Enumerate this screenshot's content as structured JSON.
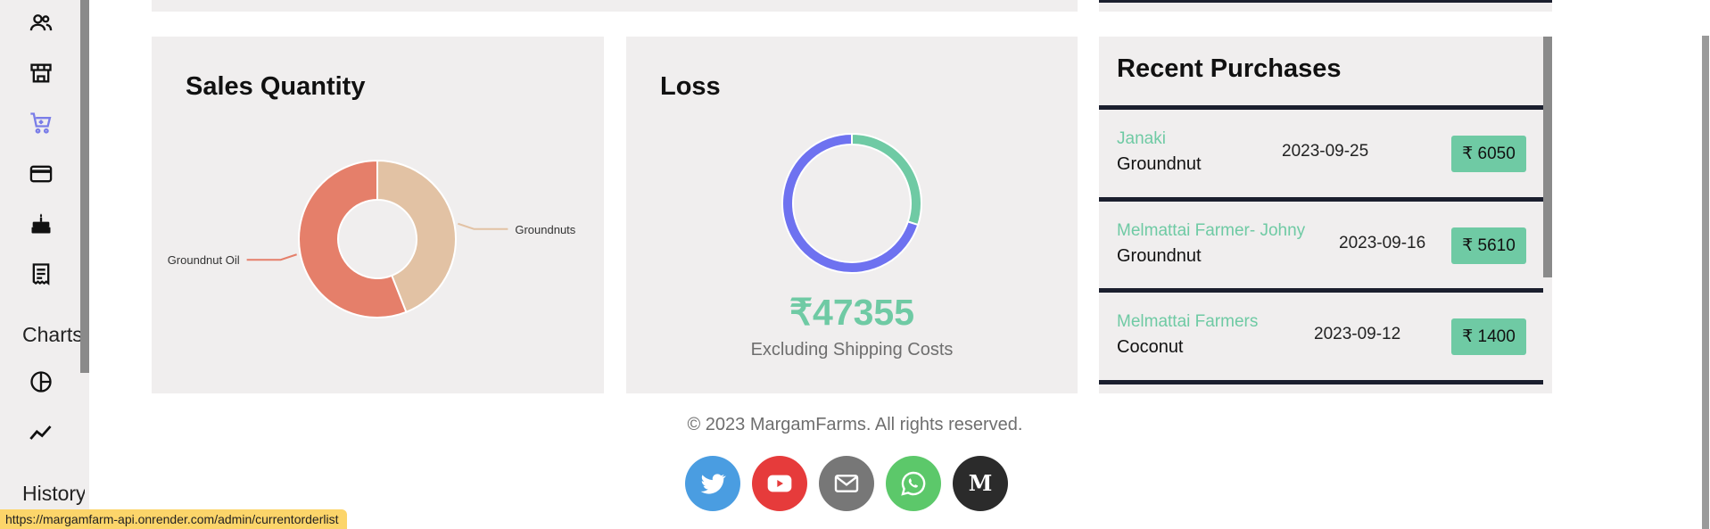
{
  "sidebar": {
    "icons": [
      {
        "name": "users-icon"
      },
      {
        "name": "store-icon"
      },
      {
        "name": "cart-icon",
        "active": true
      },
      {
        "name": "credit-card-icon"
      },
      {
        "name": "cake-icon"
      },
      {
        "name": "receipt-icon"
      }
    ],
    "charts_label": "Charts",
    "chart_icons": [
      {
        "name": "pie-chart-icon"
      },
      {
        "name": "line-chart-icon"
      }
    ],
    "history_label": "History",
    "active_color": "#7a7de8"
  },
  "sales_quantity": {
    "title": "Sales Quantity",
    "chart_data": {
      "type": "pie",
      "donut": true,
      "categories": [
        "Groundnuts",
        "Groundnut Oil"
      ],
      "values": [
        44,
        56
      ],
      "colors": [
        "#e2c2a4",
        "#e57f6a"
      ]
    }
  },
  "loss": {
    "title": "Loss",
    "value": "₹47355",
    "subtitle": "Excluding Shipping Costs",
    "chart_data": {
      "type": "pie",
      "donut": true,
      "values": [
        30,
        70
      ],
      "colors": [
        "#6fcaa4",
        "#6e72f0"
      ]
    }
  },
  "recent_purchases": {
    "title": "Recent Purchases",
    "rows": [
      {
        "name": "Janaki",
        "item": "Groundnut",
        "date": "2023-09-25",
        "price": "₹ 6050"
      },
      {
        "name": "Melmattai Farmer- Johny",
        "item": "Groundnut",
        "date": "2023-09-16",
        "price": "₹ 5610"
      },
      {
        "name": "Melmattai Farmers",
        "item": "Coconut",
        "date": "2023-09-12",
        "price": "₹ 1400"
      }
    ]
  },
  "footer": {
    "copyright": "© 2023 MargamFarms. All rights reserved.",
    "social": [
      {
        "name": "twitter-icon",
        "color": "#4a9de1"
      },
      {
        "name": "youtube-icon",
        "color": "#e63b3b"
      },
      {
        "name": "mail-icon",
        "color": "#777777"
      },
      {
        "name": "whatsapp-icon",
        "color": "#5cc86a"
      },
      {
        "name": "medium-icon",
        "color": "#2b2b2b"
      }
    ]
  },
  "status_bar": {
    "url": "https://margamfarm-api.onrender.com/admin/currentorderlist"
  }
}
